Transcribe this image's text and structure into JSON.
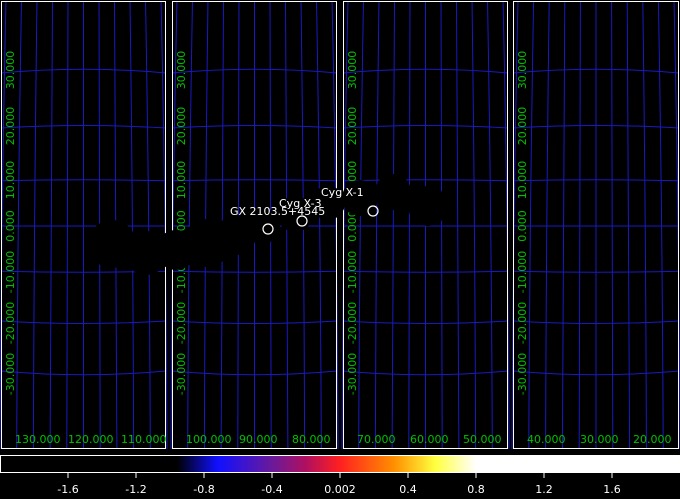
{
  "panels": [
    {
      "id": "panel-1",
      "lon_labels": [
        "130.000",
        "120.000",
        "110.000"
      ],
      "lat_labels": [
        "30.000",
        "20.000",
        "10.000",
        "0.000",
        "-10.000",
        "-20.000",
        "-30.000"
      ]
    },
    {
      "id": "panel-2",
      "lon_labels": [
        "100.000",
        "90.000",
        "80.000"
      ],
      "lat_labels": [
        "30.000",
        "20.000",
        "10.000",
        "0.000",
        "-10.000",
        "-20.000",
        "-30.000"
      ]
    },
    {
      "id": "panel-3",
      "lon_labels": [
        "70.000",
        "60.000",
        "50.000"
      ],
      "lat_labels": [
        "30.000",
        "20.000",
        "10.000",
        "0.000",
        "-10.000",
        "-20.000",
        "-30.000"
      ]
    },
    {
      "id": "panel-4",
      "lon_labels": [
        "40.000",
        "30.000",
        "20.000"
      ],
      "lat_labels": [
        "30.000",
        "20.000",
        "10.000",
        "0.000",
        "-10.000",
        "-20.000",
        "-30.000"
      ]
    }
  ],
  "sources": [
    {
      "name": "GX 2103.5+4545"
    },
    {
      "name": "Cyg X-3"
    },
    {
      "name": "Cyg X-1"
    }
  ],
  "colorbar": {
    "tick_labels": [
      "-1.6",
      "-1.2",
      "-0.8",
      "-0.4",
      "0.002",
      "0.4",
      "0.8",
      "1.2",
      "1.6"
    ]
  },
  "colors": {
    "grid": "#1a1ac0",
    "axis_label": "#00c000",
    "frame": "#ffffff",
    "source_marker": "#ffffff",
    "blob": "#000000"
  }
}
